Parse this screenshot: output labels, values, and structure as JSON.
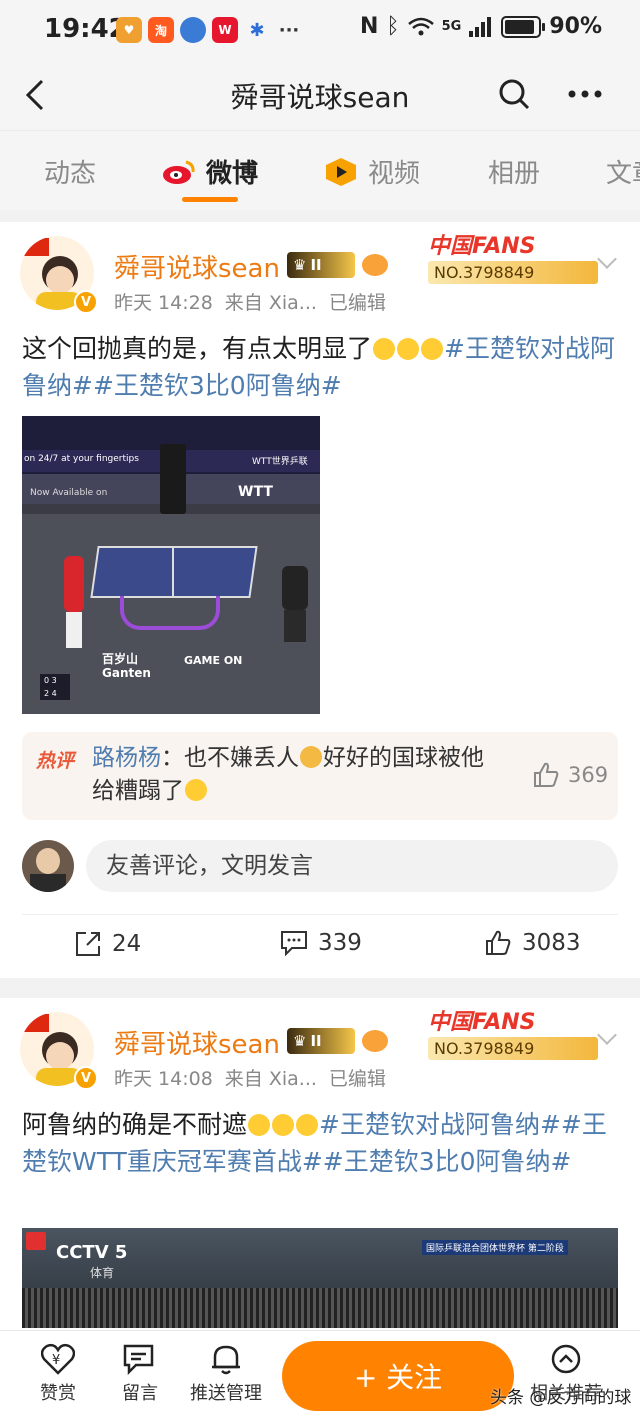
{
  "status_bar": {
    "time": "19:42",
    "network": "5G",
    "battery_pct": "90%",
    "battery_level": 0.9
  },
  "header": {
    "title": "舜哥说球sean"
  },
  "tabs": [
    {
      "label": "动态",
      "active": false
    },
    {
      "label": "微博",
      "active": true
    },
    {
      "label": "视频",
      "active": false
    },
    {
      "label": "相册",
      "active": false
    },
    {
      "label": "文章",
      "active": false
    }
  ],
  "posts": [
    {
      "username": "舜哥说球sean",
      "level_badge": "II",
      "fans_label": "中国FANS",
      "fans_no": "NO.3798849",
      "time": "昨天 14:28",
      "source": "来自 Xia...",
      "edited": "已编辑",
      "text_plain": "这个回抛真的是，有点太明显了",
      "hashtags": [
        "#王楚钦对战阿鲁纳#",
        "#王楚钦3比0阿鲁纳#"
      ],
      "image": {
        "banner_left": "on 24/7 at your fingertips",
        "banner_right": "WTT世界乒联",
        "available": "Now Available on",
        "wtt": "WTT",
        "sponsor": "百岁山 Ganten",
        "game_on": "GAME ON",
        "score_row1": [
          "0",
          "3"
        ],
        "score_row2": [
          "2",
          "4"
        ]
      },
      "hot_comment": {
        "tag": "热评",
        "author": "路杨杨",
        "text_a": "：也不嫌丢人",
        "text_b": "好好的国球被他给糟蹋了",
        "likes": "369"
      },
      "comment_placeholder": "友善评论，文明发言",
      "reposts": "24",
      "comments": "339",
      "likes": "3083"
    },
    {
      "username": "舜哥说球sean",
      "level_badge": "II",
      "fans_label": "中国FANS",
      "fans_no": "NO.3798849",
      "time": "昨天 14:08",
      "source": "来自 Xia...",
      "edited": "已编辑",
      "text_plain": "阿鲁纳的确是不耐遮",
      "hashtags": [
        "#王楚钦对战阿鲁纳#",
        "#王楚钦WTT重庆冠军赛首战#",
        "#王楚钦3比0阿鲁纳#"
      ],
      "video": {
        "channel": "CCTV 5",
        "channel_sub": "体育",
        "overlay": "国际乒联混合团体世界杯 第二阶段"
      }
    }
  ],
  "bottom_bar": {
    "items": [
      "赞赏",
      "留言",
      "推送管理"
    ],
    "follow": "+ 关注",
    "last_item": "相关推荐",
    "watermark": "头条 @反方向的球"
  },
  "colors": {
    "accent": "#ff8200",
    "link": "#507daf",
    "username": "#ec7b13"
  }
}
